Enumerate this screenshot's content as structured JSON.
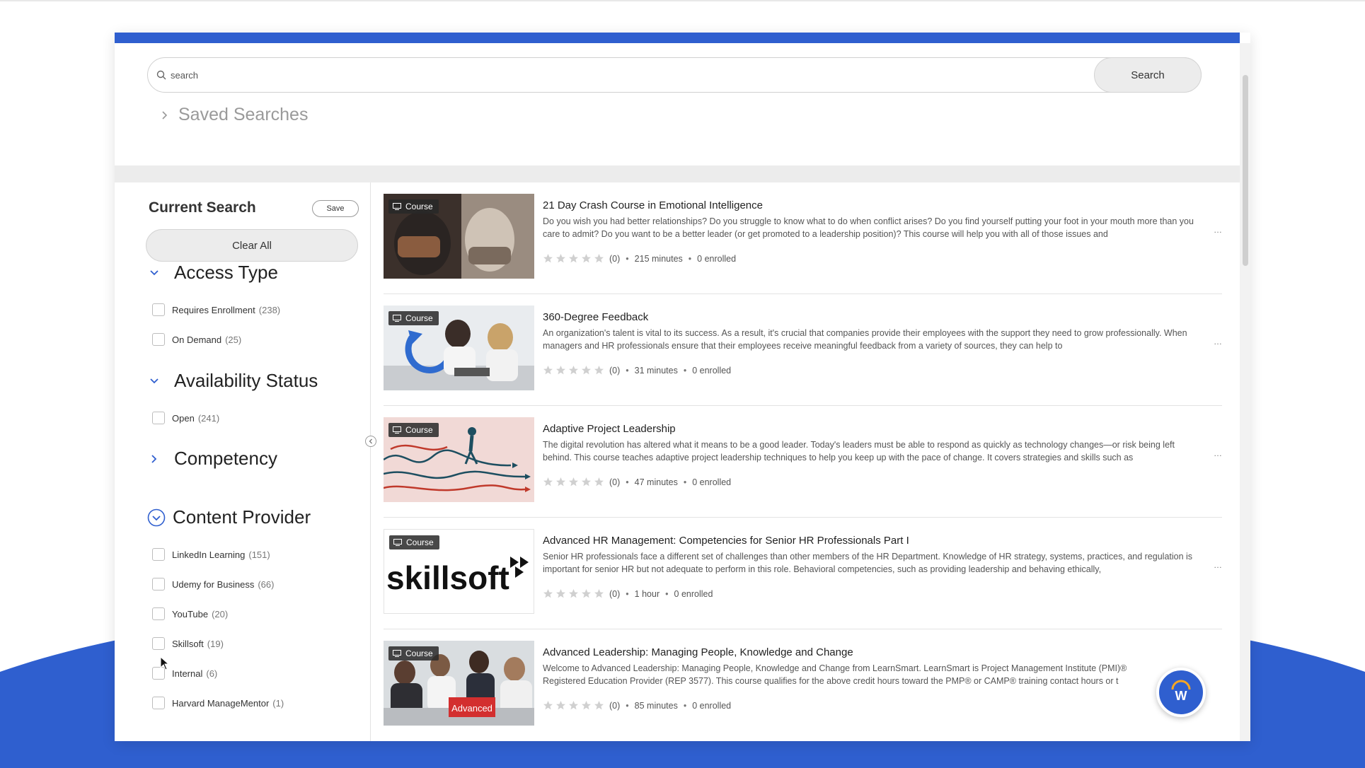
{
  "colors": {
    "brand_blue": "#2f5fcf",
    "divider_gray": "#ececec"
  },
  "search": {
    "placeholder": "search",
    "button_label": "Search"
  },
  "saved_searches": {
    "label": "Saved Searches"
  },
  "filters": {
    "title": "Current Search",
    "save_label": "Save",
    "clear_all_label": "Clear All",
    "facets": {
      "access_type": {
        "title": "Access Type",
        "options": [
          {
            "label": "Requires Enrollment",
            "count": "(238)"
          },
          {
            "label": "On Demand",
            "count": "(25)"
          }
        ]
      },
      "availability_status": {
        "title": "Availability Status",
        "options": [
          {
            "label": "Open",
            "count": "(241)"
          }
        ]
      },
      "competency": {
        "title": "Competency"
      },
      "content_provider": {
        "title": "Content Provider",
        "options": [
          {
            "label": "LinkedIn Learning",
            "count": "(151)"
          },
          {
            "label": "Udemy for Business",
            "count": "(66)"
          },
          {
            "label": "YouTube",
            "count": "(20)"
          },
          {
            "label": "Skillsoft",
            "count": "(19)"
          },
          {
            "label": "Internal",
            "count": "(6)"
          },
          {
            "label": "Harvard ManageMentor",
            "count": "(1)"
          }
        ]
      }
    }
  },
  "results": [
    {
      "badge": "Course",
      "title": "21 Day Crash Course in Emotional Intelligence",
      "description": "Do you wish you had better relationships? Do you struggle to know what to do when conflict arises? Do you find yourself putting your foot in your mouth more than you care to admit? Do you want to be a better leader (or get promoted to a leadership position)? This course will help you with all of those issues and",
      "rating": "(0)",
      "duration": "215 minutes",
      "enrolled": "0 enrolled"
    },
    {
      "badge": "Course",
      "title": "360-Degree Feedback",
      "description": "An organization's talent is vital to its success. As a result, it's crucial that companies provide their employees with the support they need to grow professionally. When managers and HR professionals ensure that their employees receive meaningful feedback from a variety of sources, they can help to",
      "rating": "(0)",
      "duration": "31 minutes",
      "enrolled": "0 enrolled"
    },
    {
      "badge": "Course",
      "title": "Adaptive Project Leadership",
      "description": "The digital revolution has altered what it means to be a good leader. Today's leaders must be able to respond as quickly as technology changes—or risk being left behind. This course teaches adaptive project leadership techniques to help you keep up with the pace of change. It covers strategies and skills such as",
      "rating": "(0)",
      "duration": "47 minutes",
      "enrolled": "0 enrolled"
    },
    {
      "badge": "Course",
      "title": "Advanced HR Management: Competencies for Senior HR Professionals Part I",
      "description": "Senior HR professionals face a different set of challenges than other members of the HR Department. Knowledge of HR strategy, systems, practices, and regulation is important for senior HR but not adequate to perform in this role. Behavioral competencies, such as providing leadership and behaving ethically,",
      "rating": "(0)",
      "duration": "1 hour",
      "enrolled": "0 enrolled",
      "thumb_text": "skillsoft"
    },
    {
      "badge": "Course",
      "title": "Advanced Leadership: Managing People, Knowledge and Change",
      "description": "Welcome to Advanced Leadership: Managing People, Knowledge and Change from LearnSmart. LearnSmart is Project Management Institute (PMI)® Registered Education Provider (REP 3577). This course qualifies for the above credit hours toward the PMP® or CAMP® training contact hours or t",
      "rating": "(0)",
      "duration": "85 minutes",
      "enrolled": "0 enrolled",
      "thumb_text": "Advanced"
    }
  ],
  "ellipsis": "…",
  "chat": {
    "icon_letter": "W"
  }
}
